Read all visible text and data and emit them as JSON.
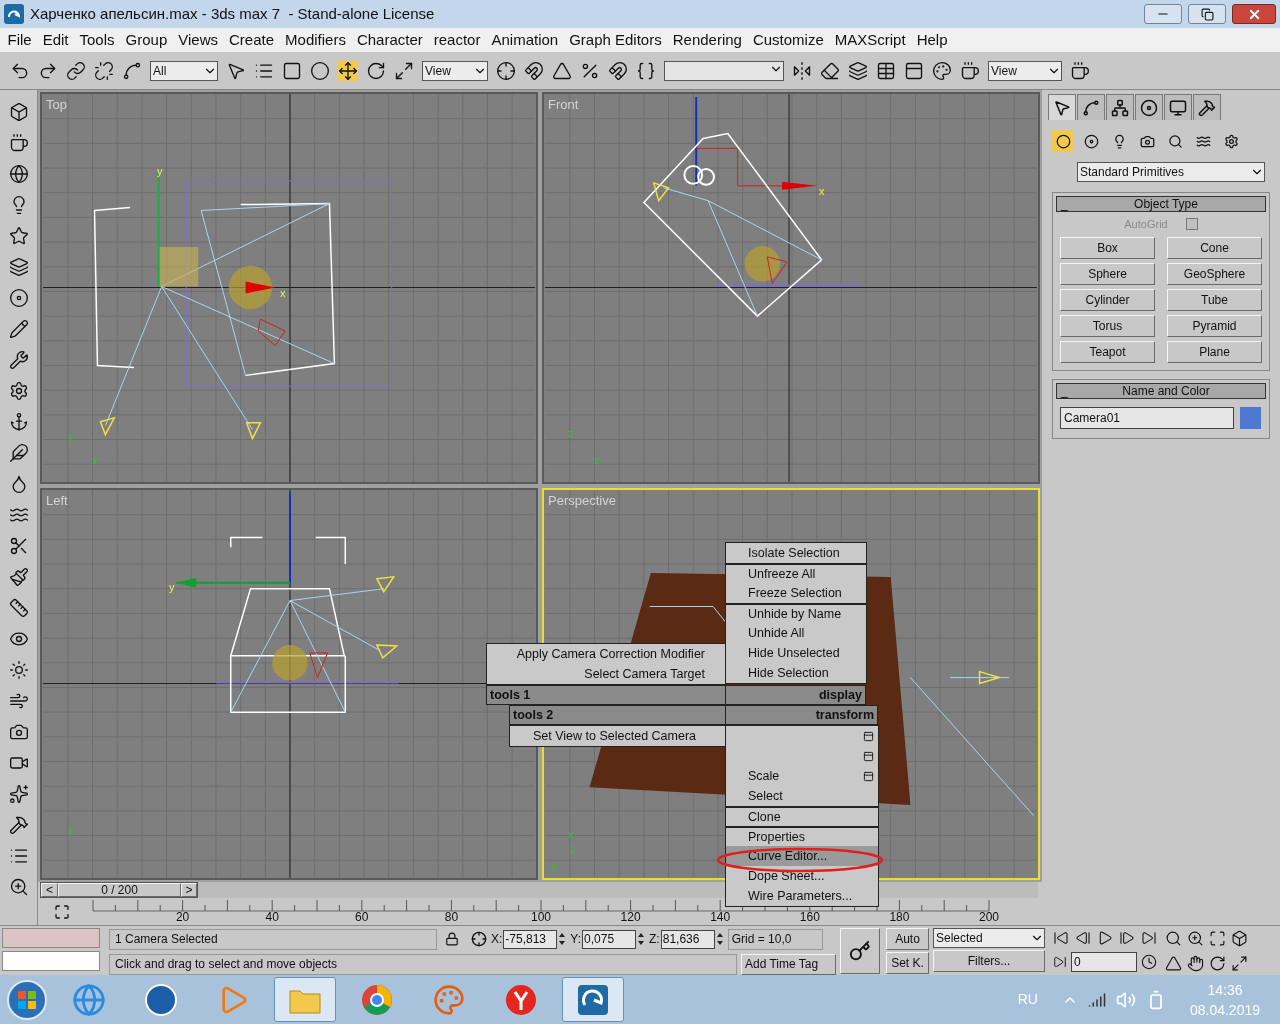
{
  "window": {
    "title": "Харченко апельсин.max - 3ds max 7  - Stand-alone License"
  },
  "menu": [
    "File",
    "Edit",
    "Tools",
    "Group",
    "Views",
    "Create",
    "Modifiers",
    "Character",
    "reactor",
    "Animation",
    "Graph Editors",
    "Rendering",
    "Customize",
    "MAXScript",
    "Help"
  ],
  "toolbar": {
    "selection_filter": "All",
    "reference_coordinate_system": "View",
    "render_type": "View",
    "move_tool_selected": true
  },
  "viewports": [
    {
      "label": "Top",
      "active": false,
      "tripod": [
        "y",
        "x"
      ],
      "gizmo": [
        "y",
        "x"
      ]
    },
    {
      "label": "Front",
      "active": false,
      "tripod": [
        "z",
        "x"
      ],
      "gizmo": [
        "x"
      ]
    },
    {
      "label": "Left",
      "active": false,
      "tripod": [
        "z"
      ],
      "gizmo": [
        "y"
      ]
    },
    {
      "label": "Perspective",
      "active": true,
      "tripod": [
        "x",
        "z",
        "y"
      ]
    }
  ],
  "quad_menu": {
    "tools1": {
      "title": "tools 1",
      "items": [
        {
          "label": "Apply Camera Correction Modifier",
          "selected": false
        },
        {
          "label": "Select Camera Target",
          "selected": false
        }
      ]
    },
    "display": {
      "title": "display",
      "items": [
        {
          "label": "Isolate Selection",
          "selected": false,
          "separator_before": false
        },
        {
          "label": "Unfreeze All",
          "selected": false,
          "separator_before": true
        },
        {
          "label": "Freeze Selection",
          "selected": false,
          "separator_before": false
        },
        {
          "label": "Unhide by Name",
          "selected": false,
          "separator_before": true
        },
        {
          "label": "Unhide All",
          "selected": false,
          "separator_before": false
        },
        {
          "label": "Hide Unselected",
          "selected": false,
          "separator_before": false
        },
        {
          "label": "Hide Selection",
          "selected": false,
          "separator_before": false
        }
      ]
    },
    "tools2": {
      "title": "tools 2",
      "items": [
        {
          "label": "Set View to Selected Camera",
          "selected": false
        }
      ]
    },
    "transform": {
      "title": "transform",
      "items": [
        {
          "options": true,
          "selected": false,
          "separator_before": false
        },
        {
          "options": true,
          "selected": false,
          "separator_before": false
        },
        {
          "label": "Scale",
          "options": true,
          "selected": false,
          "separator_before": false
        },
        {
          "label": "Select",
          "options": false,
          "selected": false,
          "separator_before": false
        },
        {
          "label": "Clone",
          "options": false,
          "selected": false,
          "separator_before": true
        },
        {
          "label": "Properties",
          "options": false,
          "selected": false,
          "separator_before": true
        },
        {
          "label": "Curve Editor...",
          "options": false,
          "selected": true,
          "separator_before": false
        },
        {
          "label": "Dope Sheet...",
          "options": false,
          "selected": false,
          "separator_before": false
        },
        {
          "label": "Wire Parameters...",
          "options": false,
          "selected": false,
          "separator_before": false
        }
      ]
    }
  },
  "command_panel": {
    "tabs": [
      {
        "selected": true
      },
      {
        "selected": false
      },
      {
        "selected": false
      },
      {
        "selected": false
      },
      {
        "selected": false
      },
      {
        "selected": false
      }
    ],
    "categories": [
      {
        "selected": true
      },
      {
        "selected": false
      },
      {
        "selected": false
      },
      {
        "selected": false
      },
      {
        "selected": false
      },
      {
        "selected": false
      },
      {
        "selected": false
      }
    ],
    "dropdown": "Standard Primitives",
    "object_type": {
      "toggle": "_",
      "title": "Object Type",
      "autogrid": {
        "label": "AutoGrid",
        "checked": false,
        "disabled": true
      },
      "buttons": [
        "Box",
        "Cone",
        "Sphere",
        "GeoSphere",
        "Cylinder",
        "Tube",
        "Torus",
        "Pyramid",
        "Teapot",
        "Plane"
      ]
    },
    "name_and_color": {
      "toggle": "_",
      "title": "Name and Color",
      "name": "Camera01",
      "color": "#4f79d0"
    }
  },
  "time_slider": {
    "label": "0 / 200",
    "prev": "<",
    "next": ">",
    "level": 0
  },
  "track_bar": {
    "ticks": [
      "20",
      "40",
      "60",
      "80",
      "100",
      "120",
      "140",
      "160",
      "180",
      "200"
    ]
  },
  "status": {
    "selection": "1 Camera Selected",
    "prompt": "Click and drag to select and move objects",
    "coords": [
      {
        "label": "X:",
        "value": "-75,813"
      },
      {
        "label": "Y:",
        "value": "0,075"
      },
      {
        "label": "Z:",
        "value": "81,636"
      }
    ],
    "grid": "Grid = 10,0",
    "time_tag": "Add Time Tag",
    "auto_key": "Auto",
    "set_key": "Set K.",
    "key_filter": "Selected",
    "filters": "Filters...",
    "frame": "0"
  },
  "taskbar": {
    "apps": [
      {
        "kind": "browser",
        "active": false
      },
      {
        "kind": "round",
        "active": false
      },
      {
        "kind": "media",
        "active": false
      },
      {
        "kind": "folder",
        "active": true
      },
      {
        "kind": "chrome",
        "active": false
      },
      {
        "kind": "paint",
        "active": false
      },
      {
        "kind": "yandex",
        "active": false
      },
      {
        "kind": "max",
        "active": true
      }
    ],
    "language": "RU",
    "time": "14:36",
    "date": "08.04.2019"
  }
}
